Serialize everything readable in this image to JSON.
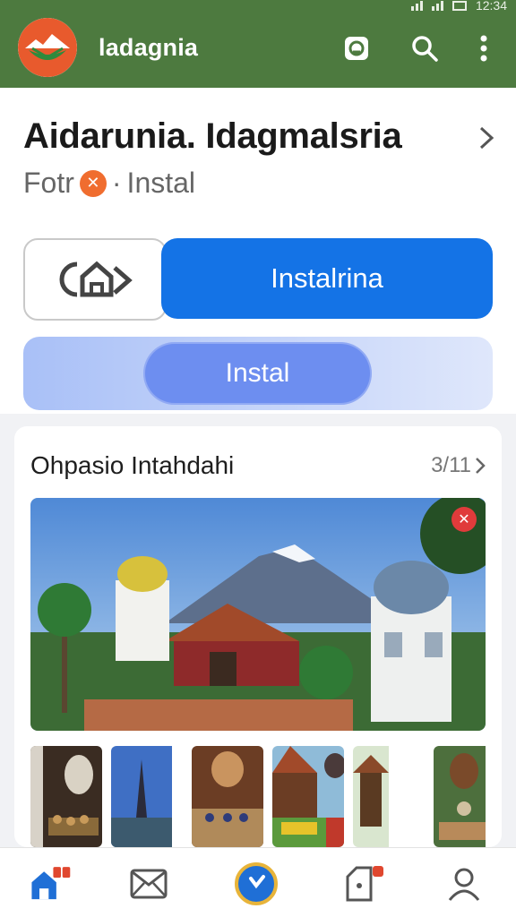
{
  "status": {
    "time": "12:34"
  },
  "appbar": {
    "title": "ladagnia",
    "icons": [
      "screen-icon",
      "search-icon",
      "more-vert-icon"
    ]
  },
  "app": {
    "name": "Aidarunia. Idagmalsria",
    "developer": "Fotr",
    "separator": "·",
    "category": "Instal"
  },
  "actions": {
    "primary_label": "Instalrina",
    "secondary_label": "Instal"
  },
  "gallery": {
    "title": "Ohpasio Intahdahi",
    "count": "3/11"
  },
  "bottom_nav": {
    "items": [
      "home-icon",
      "mail-icon",
      "play-icon",
      "notification-icon",
      "profile-icon"
    ]
  },
  "colors": {
    "appbar": "#4d7a3f",
    "primary": "#1473e6",
    "secondary": "#6d8ef0",
    "badge": "#e03b3b"
  }
}
